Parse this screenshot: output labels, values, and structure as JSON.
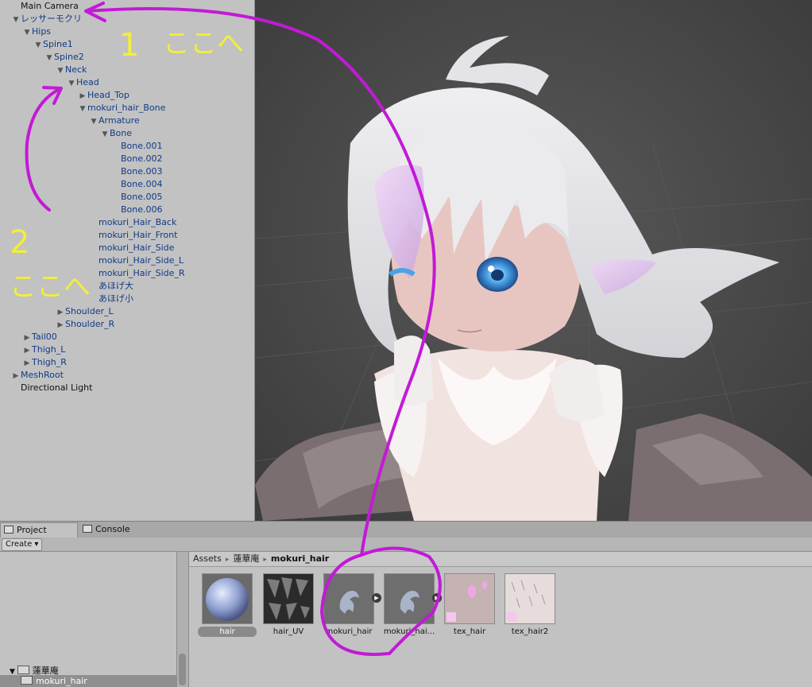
{
  "hierarchy": {
    "items": [
      {
        "label": "Main Camera",
        "toggle": "none",
        "style": "plain"
      },
      {
        "label": "レッサーモクリ",
        "toggle": "open",
        "style": "prefab"
      },
      {
        "label": "Hips",
        "toggle": "open",
        "style": "prefab"
      },
      {
        "label": "Spine1",
        "toggle": "open",
        "style": "prefab"
      },
      {
        "label": "Spine2",
        "toggle": "open",
        "style": "prefab"
      },
      {
        "label": "Neck",
        "toggle": "open",
        "style": "prefab"
      },
      {
        "label": "Head",
        "toggle": "open",
        "style": "prefab"
      },
      {
        "label": "Head_Top",
        "toggle": "closed",
        "style": "prefab"
      },
      {
        "label": "mokuri_hair_Bone",
        "toggle": "open",
        "style": "prefab"
      },
      {
        "label": "Armature",
        "toggle": "open",
        "style": "prefab"
      },
      {
        "label": "Bone",
        "toggle": "open",
        "style": "prefab"
      },
      {
        "label": "Bone.001",
        "toggle": "none",
        "style": "prefab"
      },
      {
        "label": "Bone.002",
        "toggle": "none",
        "style": "prefab"
      },
      {
        "label": "Bone.003",
        "toggle": "none",
        "style": "prefab"
      },
      {
        "label": "Bone.004",
        "toggle": "none",
        "style": "prefab"
      },
      {
        "label": "Bone.005",
        "toggle": "none",
        "style": "prefab"
      },
      {
        "label": "Bone.006",
        "toggle": "none",
        "style": "prefab"
      },
      {
        "label": "mokuri_Hair_Back",
        "toggle": "none",
        "style": "prefab"
      },
      {
        "label": "mokuri_Hair_Front",
        "toggle": "none",
        "style": "prefab"
      },
      {
        "label": "mokuri_Hair_Side",
        "toggle": "none",
        "style": "prefab"
      },
      {
        "label": "mokuri_Hair_Side_L",
        "toggle": "none",
        "style": "prefab"
      },
      {
        "label": "mokuri_Hair_Side_R",
        "toggle": "none",
        "style": "prefab"
      },
      {
        "label": "あほげ大",
        "toggle": "none",
        "style": "prefab"
      },
      {
        "label": "あほげ小",
        "toggle": "none",
        "style": "prefab"
      },
      {
        "label": "Shoulder_L",
        "toggle": "closed",
        "style": "prefab"
      },
      {
        "label": "Shoulder_R",
        "toggle": "closed",
        "style": "prefab"
      },
      {
        "label": "Tail00",
        "toggle": "closed",
        "style": "prefab"
      },
      {
        "label": "Thigh_L",
        "toggle": "closed",
        "style": "prefab"
      },
      {
        "label": "Thigh_R",
        "toggle": "closed",
        "style": "prefab"
      },
      {
        "label": "MeshRoot",
        "toggle": "closed",
        "style": "prefab"
      },
      {
        "label": "Directional Light",
        "toggle": "none",
        "style": "plain"
      }
    ]
  },
  "annotations": {
    "note1_number": "1",
    "note1_text": "ここへ",
    "note2_number": "2",
    "note2_text": "ここへ",
    "color": "#c21ad6",
    "text_color": "#f3ee3a"
  },
  "tabs": [
    {
      "label": "Project",
      "icon": "folder-icon",
      "active": true
    },
    {
      "label": "Console",
      "icon": "console-icon",
      "active": false
    }
  ],
  "toolbar": {
    "create_label": "Create ▾"
  },
  "folders": [
    {
      "label": "蓮華庵",
      "toggle": "open",
      "selected": false
    },
    {
      "label": "mokuri_hair",
      "toggle": "none",
      "selected": true
    }
  ],
  "breadcrumb": {
    "items": [
      "Assets",
      "蓮華庵",
      "mokuri_hair"
    ],
    "separator": "▸"
  },
  "assets": [
    {
      "label": "hair",
      "kind": "material",
      "selected": true,
      "playable": false
    },
    {
      "label": "hair_UV",
      "kind": "texture-dark",
      "selected": false,
      "playable": false
    },
    {
      "label": "mokuri_hair",
      "kind": "model",
      "selected": false,
      "playable": true
    },
    {
      "label": "mokuri_hai...",
      "kind": "model",
      "selected": false,
      "playable": true
    },
    {
      "label": "tex_hair",
      "kind": "texture-pink",
      "selected": false,
      "playable": false
    },
    {
      "label": "tex_hair2",
      "kind": "texture-light",
      "selected": false,
      "playable": false
    }
  ]
}
